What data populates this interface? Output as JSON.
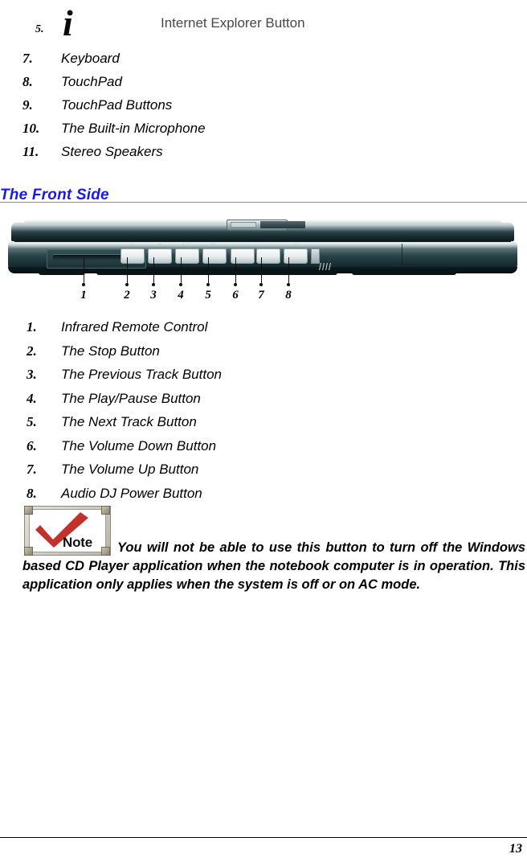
{
  "document": {
    "page_number": "13"
  },
  "continued_list": {
    "ie_item": {
      "number": "5.",
      "icon_glyph": "i",
      "label": "Internet Explorer Button"
    },
    "items": [
      {
        "number": "7.",
        "label": "Keyboard"
      },
      {
        "number": "8.",
        "label": "TouchPad"
      },
      {
        "number": "9.",
        "label": "TouchPad Buttons"
      },
      {
        "number": "10.",
        "label": "The Built-in Microphone"
      },
      {
        "number": "11.",
        "label": "Stereo Speakers"
      }
    ]
  },
  "section": {
    "heading": "The Front Side",
    "heading_color": "#1a1ae6"
  },
  "figure": {
    "caption_numbers": [
      "1",
      "2",
      "3",
      "4",
      "5",
      "6",
      "7",
      "8"
    ],
    "button_icons": [
      "■",
      "|◀◀",
      "▶||",
      "▶▶|",
      "−",
      "+",
      "⏻"
    ]
  },
  "front_side_list": [
    {
      "number": "1.",
      "label": "Infrared Remote Control"
    },
    {
      "number": "2.",
      "label": "The Stop Button"
    },
    {
      "number": "3.",
      "label": "The Previous Track Button"
    },
    {
      "number": "4.",
      "label": "The Play/Pause Button"
    },
    {
      "number": "5.",
      "label": "The Next Track Button"
    },
    {
      "number": "6.",
      "label": "The Volume Down Button"
    },
    {
      "number": "7.",
      "label": "The Volume Up Button"
    },
    {
      "number": "8.",
      "label": "Audio DJ Power Button"
    }
  ],
  "note": {
    "icon_label": "Note",
    "check_color": "#c0322b",
    "text": "You will not be able to use this button to turn off the Windows based CD Player application when the notebook computer is in operation.  This application only applies when the system is off or on AC mode."
  }
}
